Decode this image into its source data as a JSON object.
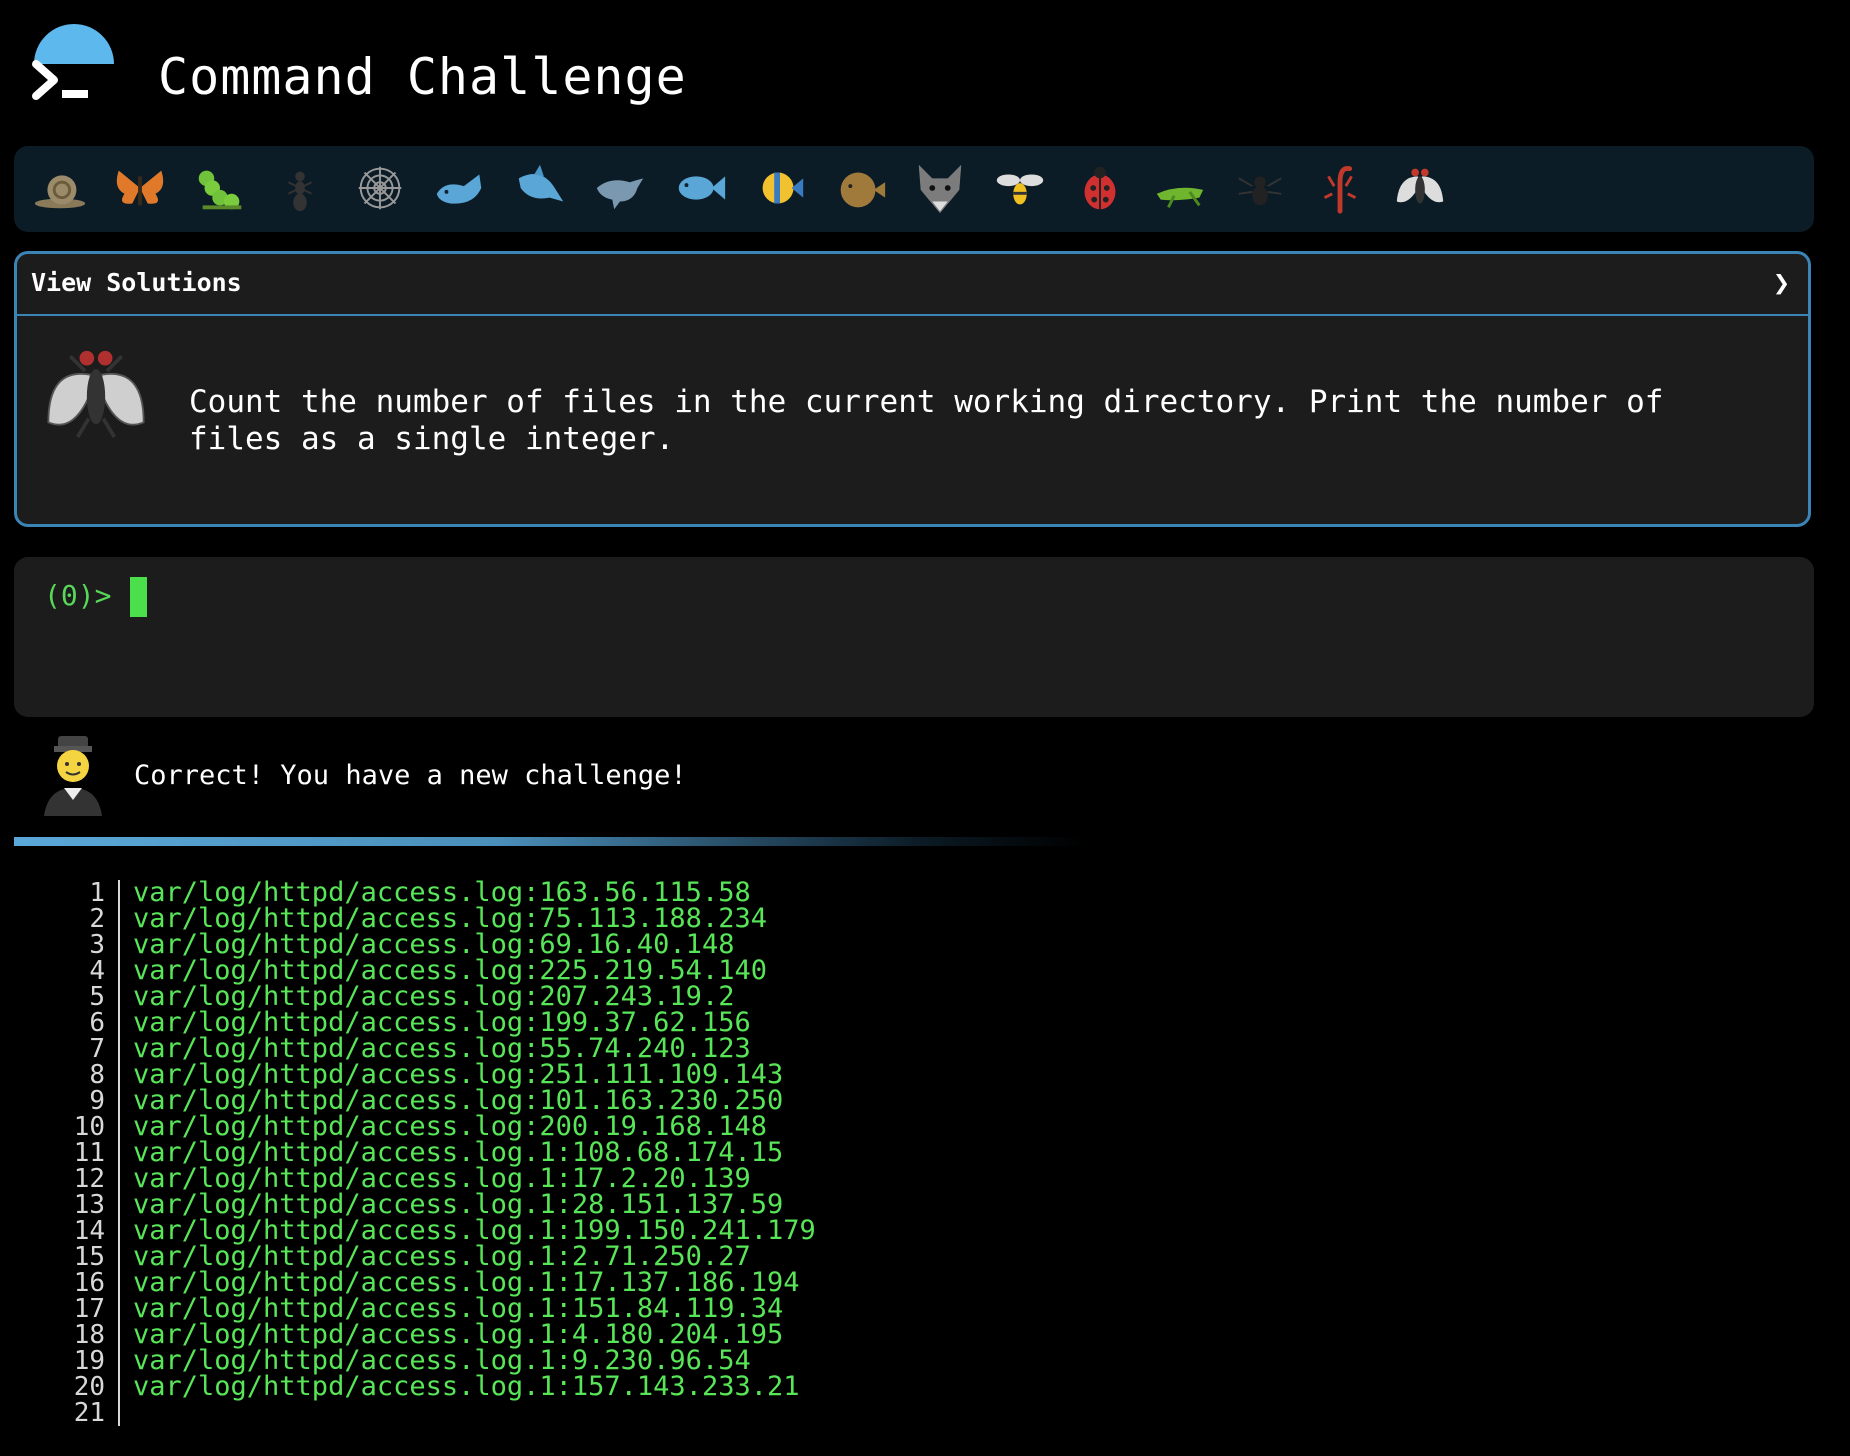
{
  "header": {
    "title": "Command Challenge",
    "logo_icon": "terminal-prompt-icon"
  },
  "animal_bar": {
    "items": [
      {
        "name": "snail-icon"
      },
      {
        "name": "butterfly-icon"
      },
      {
        "name": "caterpillar-icon"
      },
      {
        "name": "ant-icon"
      },
      {
        "name": "spider-web-icon"
      },
      {
        "name": "whale-icon"
      },
      {
        "name": "shark-icon"
      },
      {
        "name": "dolphin-icon"
      },
      {
        "name": "fish-icon"
      },
      {
        "name": "tropical-fish-icon"
      },
      {
        "name": "blowfish-icon"
      },
      {
        "name": "wolf-icon"
      },
      {
        "name": "bee-icon"
      },
      {
        "name": "ladybug-icon"
      },
      {
        "name": "cricket-icon"
      },
      {
        "name": "spider-icon"
      },
      {
        "name": "scorpion-icon"
      },
      {
        "name": "fly-icon"
      }
    ]
  },
  "solutions": {
    "title": "View Solutions",
    "chevron": "❯",
    "challenge_icon": "fly-icon",
    "challenge_text": "Count the number of files in the current working directory. Print the number of\nfiles as a single integer."
  },
  "terminal": {
    "prompt_open": "(",
    "prompt_code": "0",
    "prompt_close": ")>",
    "input_value": ""
  },
  "message": {
    "avatar_icon": "judge-person-icon",
    "text": "Correct! You have a new challenge!"
  },
  "output": {
    "lines": [
      {
        "n": "1",
        "text": "var/log/httpd/access.log:163.56.115.58"
      },
      {
        "n": "2",
        "text": "var/log/httpd/access.log:75.113.188.234"
      },
      {
        "n": "3",
        "text": "var/log/httpd/access.log:69.16.40.148"
      },
      {
        "n": "4",
        "text": "var/log/httpd/access.log:225.219.54.140"
      },
      {
        "n": "5",
        "text": "var/log/httpd/access.log:207.243.19.2"
      },
      {
        "n": "6",
        "text": "var/log/httpd/access.log:199.37.62.156"
      },
      {
        "n": "7",
        "text": "var/log/httpd/access.log:55.74.240.123"
      },
      {
        "n": "8",
        "text": "var/log/httpd/access.log:251.111.109.143"
      },
      {
        "n": "9",
        "text": "var/log/httpd/access.log:101.163.230.250"
      },
      {
        "n": "10",
        "text": "var/log/httpd/access.log:200.19.168.148"
      },
      {
        "n": "11",
        "text": "var/log/httpd/access.log.1:108.68.174.15"
      },
      {
        "n": "12",
        "text": "var/log/httpd/access.log.1:17.2.20.139"
      },
      {
        "n": "13",
        "text": "var/log/httpd/access.log.1:28.151.137.59"
      },
      {
        "n": "14",
        "text": "var/log/httpd/access.log.1:199.150.241.179"
      },
      {
        "n": "15",
        "text": "var/log/httpd/access.log.1:2.71.250.27"
      },
      {
        "n": "16",
        "text": "var/log/httpd/access.log.1:17.137.186.194"
      },
      {
        "n": "17",
        "text": "var/log/httpd/access.log.1:151.84.119.34"
      },
      {
        "n": "18",
        "text": "var/log/httpd/access.log.1:4.180.204.195"
      },
      {
        "n": "19",
        "text": "var/log/httpd/access.log.1:9.230.96.54"
      },
      {
        "n": "20",
        "text": "var/log/httpd/access.log.1:157.143.233.21"
      },
      {
        "n": "21",
        "text": ""
      }
    ]
  },
  "colors": {
    "accent_blue": "#3a85b5",
    "terminal_green": "#58e658",
    "panel_bg": "#1c1c1c"
  }
}
